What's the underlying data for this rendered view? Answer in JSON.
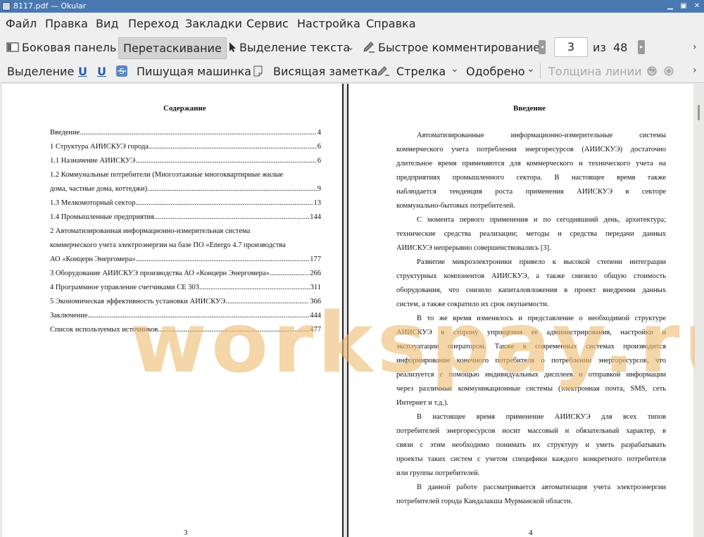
{
  "window": {
    "title": "8117.pdf  — Okular"
  },
  "menu": [
    "Файл",
    "Правка",
    "Вид",
    "Переход",
    "Закладки",
    "Сервис",
    "Настройка",
    "Справка"
  ],
  "toolbar1": {
    "sidebar": "Боковая панель",
    "drag": "Перетаскивание",
    "text_select": "Выделение текста",
    "quick_comment": "Быстрое комментирование",
    "page_current": "3",
    "page_of": "из",
    "page_total": "48"
  },
  "toolbar2": {
    "highlight": "Выделение",
    "typewriter": "Пишущая машинка",
    "sticky_note": "Висящая заметка",
    "arrow": "Стрелка",
    "approved": "Одобрено",
    "line_width": "Толщина линии"
  },
  "page_left": {
    "heading": "Содержание",
    "toc": [
      {
        "label": "Введение",
        "page": "4"
      },
      {
        "label": "1 Структура АИИСКУЭ города",
        "page": "6"
      },
      {
        "label": "1.1 Назначение АИИСКУЭ",
        "page": "6"
      },
      {
        "label_line1": "1.2 Коммунальные потребители (Многоэтажные многоквартирные жилые",
        "label": "дома, частные дома, коттеджи).",
        "page": "9"
      },
      {
        "label": "1.3 Мелкомоторный сектор",
        "page": "13"
      },
      {
        "label": "1.4 Промышленные предприятия.",
        "page": "144"
      },
      {
        "label_line1": "2 Автоматизированная информационно-измерительная система",
        "label_line2": "коммерческого учета электроэнергии на базе ПО «Energo 4.7 производства",
        "label": "АО «Концерн Энергомера»",
        "page": "177"
      },
      {
        "label": "3 Оборудование АИИСКУЭ производства АО «Концерн Энергомера»",
        "page": "266"
      },
      {
        "label": "4 Программное управление счетчиками СЕ 303",
        "page": "311"
      },
      {
        "label": "5 Экономическая эффективность установки АИИСКУЭ",
        "page": "366"
      },
      {
        "label": "Заключение",
        "page": "444"
      },
      {
        "label": "Список используемых источников",
        "page": "477"
      }
    ],
    "page_number": "3"
  },
  "page_right": {
    "heading": "Введение",
    "lines": [
      "Автоматизированные информационно-измерительные системы",
      "коммерческого учета потребления энергоресурсов (АИИСКУЭ) достаточно",
      "длительное время применяются для коммерческого и технического учета на",
      "предприятиях промышленного сектора. В настоящее время также",
      "наблюдается тенденция роста применения АИИСКУЭ в секторе",
      "коммунально-бытовых потребителей.",
      "С момента первого применения и по сегодняшний день, архитектура;",
      "технические средства реализации; методы и средства передачи данных",
      "АИИСКУЭ непрерывно совершенствовались [3].",
      "Развитие микроэлектроники привело к высокой степени интеграции",
      "структурных компонентов АИИСКУЭ, а также снизило общую стоимость",
      "оборудования, что снизило капиталовложения в проект внедрения данных",
      "систем, а также сократило их срок окупаемости.",
      "В то же время изменялось и представление о необходимой структуре",
      "АИИСКУЭ в сторону упрощения ее администрирования, настройки и",
      "эксплуатации оператором. Также в современных системах производится",
      "информирование конечного потребителя о потреблении энергоресурсов, что",
      "реализуется с помощью индивидуальных дисплеев и отправкой информации",
      "через различные коммуникационные системы (электронная почта, SMS, сеть",
      "Интернет и т.д.).",
      "В настоящее время применение АИИСКУЭ для всех типов",
      "потребителей энергоресурсов носит массовый и обязательный характер, в",
      "связи с этим необходимо понимать их структуру и уметь разрабатывать",
      "проекты таких систем с учетом специфики каждого конкретного потребителя",
      "или группы потребителей.",
      "В данной работе рассматривается автоматизация учета электроэнергии",
      "потребителей города Кандалакша Мурманской области."
    ],
    "page_number": "4"
  },
  "watermark": "workspay.ru"
}
